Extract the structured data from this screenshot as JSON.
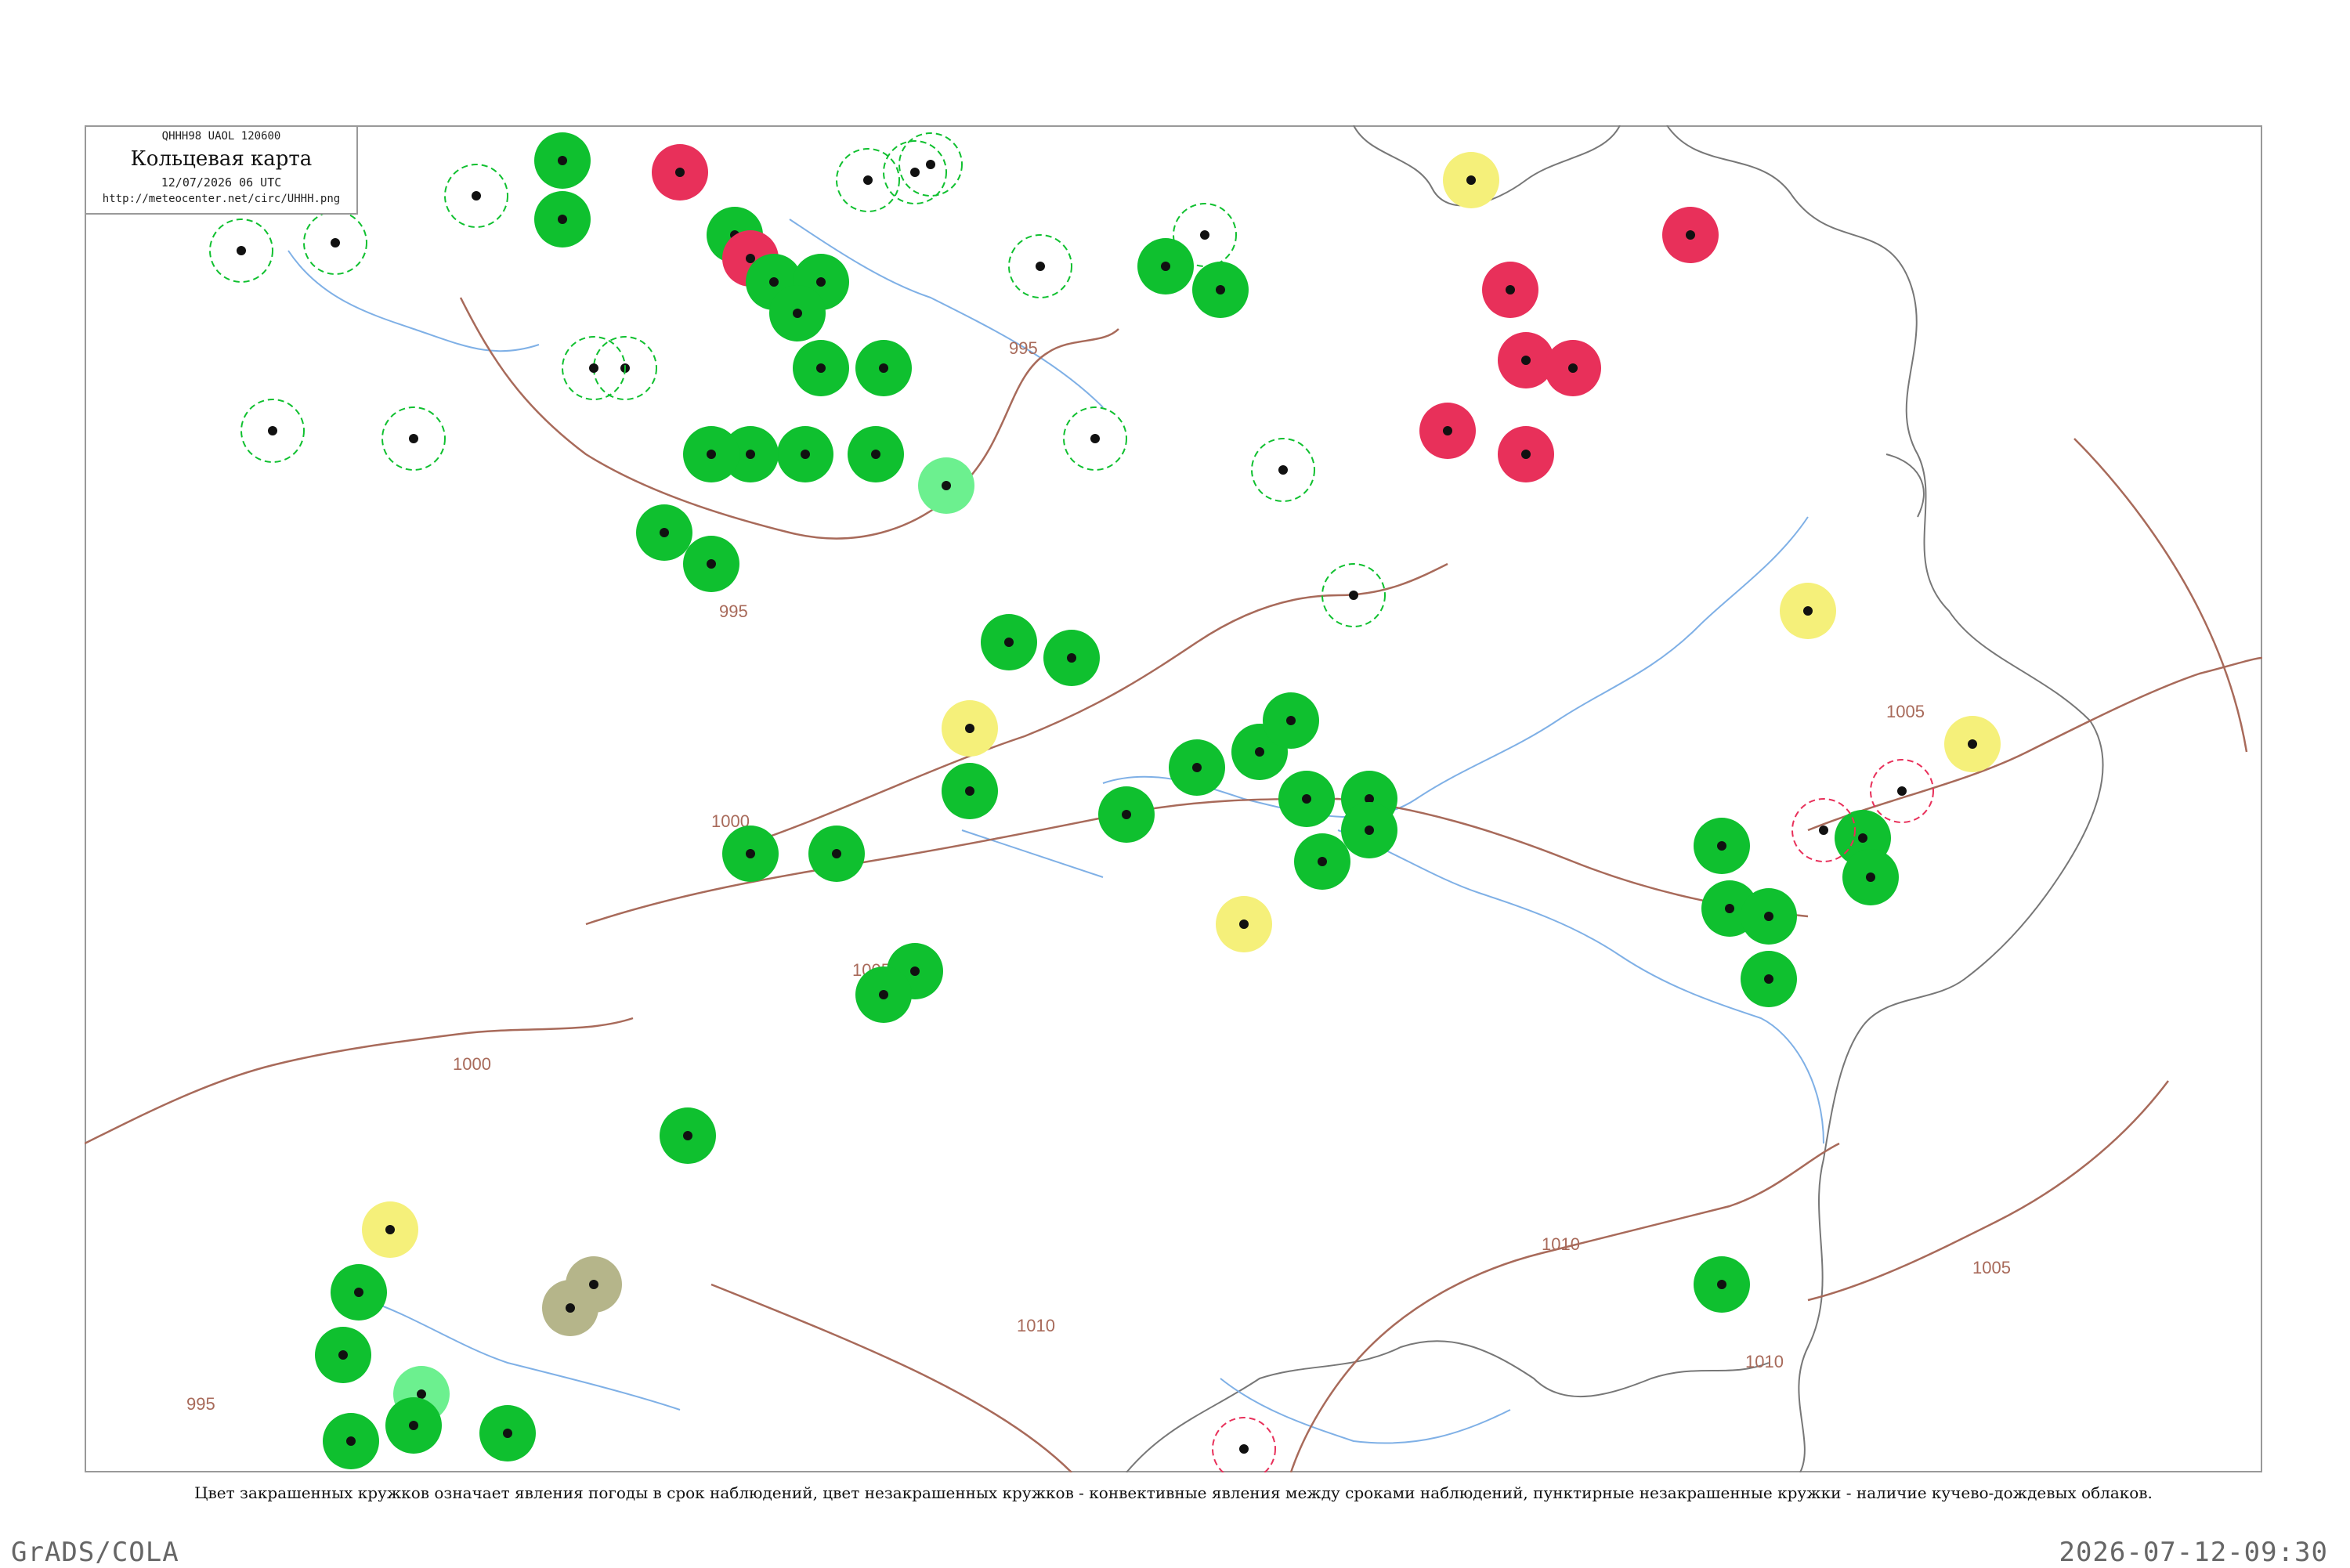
{
  "header": {
    "code": "QHHH98  UAOL  120600",
    "title": "Кольцевая карта",
    "datetime": "12/07/2026 06 UTC",
    "url": "http://meteocenter.net/circ/UHHH.png"
  },
  "caption": "Цвет закрашенных кружков означает явления погоды в срок наблюдений, цвет незакрашенных кружков - конвективные явления между сроками наблюдений, пунктирные незакрашенные кружки - наличие кучево-дождевых облаков.",
  "footer": {
    "left": "GrADS/COLA",
    "right": "2026-07-12-09:30"
  },
  "isobars": [
    "995",
    "995",
    "1000",
    "1000",
    "1005",
    "1005",
    "1010",
    "1010",
    "1010",
    "1005",
    "995"
  ],
  "colors": {
    "green": "#0fc02f",
    "red": "#e8305a",
    "yellow": "#f5f07a",
    "olive": "#b5b58a",
    "light_green": "#6cf08f",
    "isobar": "#a86a5a",
    "river": "#7fb0e6",
    "coast": "#777777"
  },
  "stations": [
    {
      "id": "",
      "p": "",
      "t": ""
    },
    {
      "id": "",
      "p": "",
      "t": ""
    }
  ]
}
